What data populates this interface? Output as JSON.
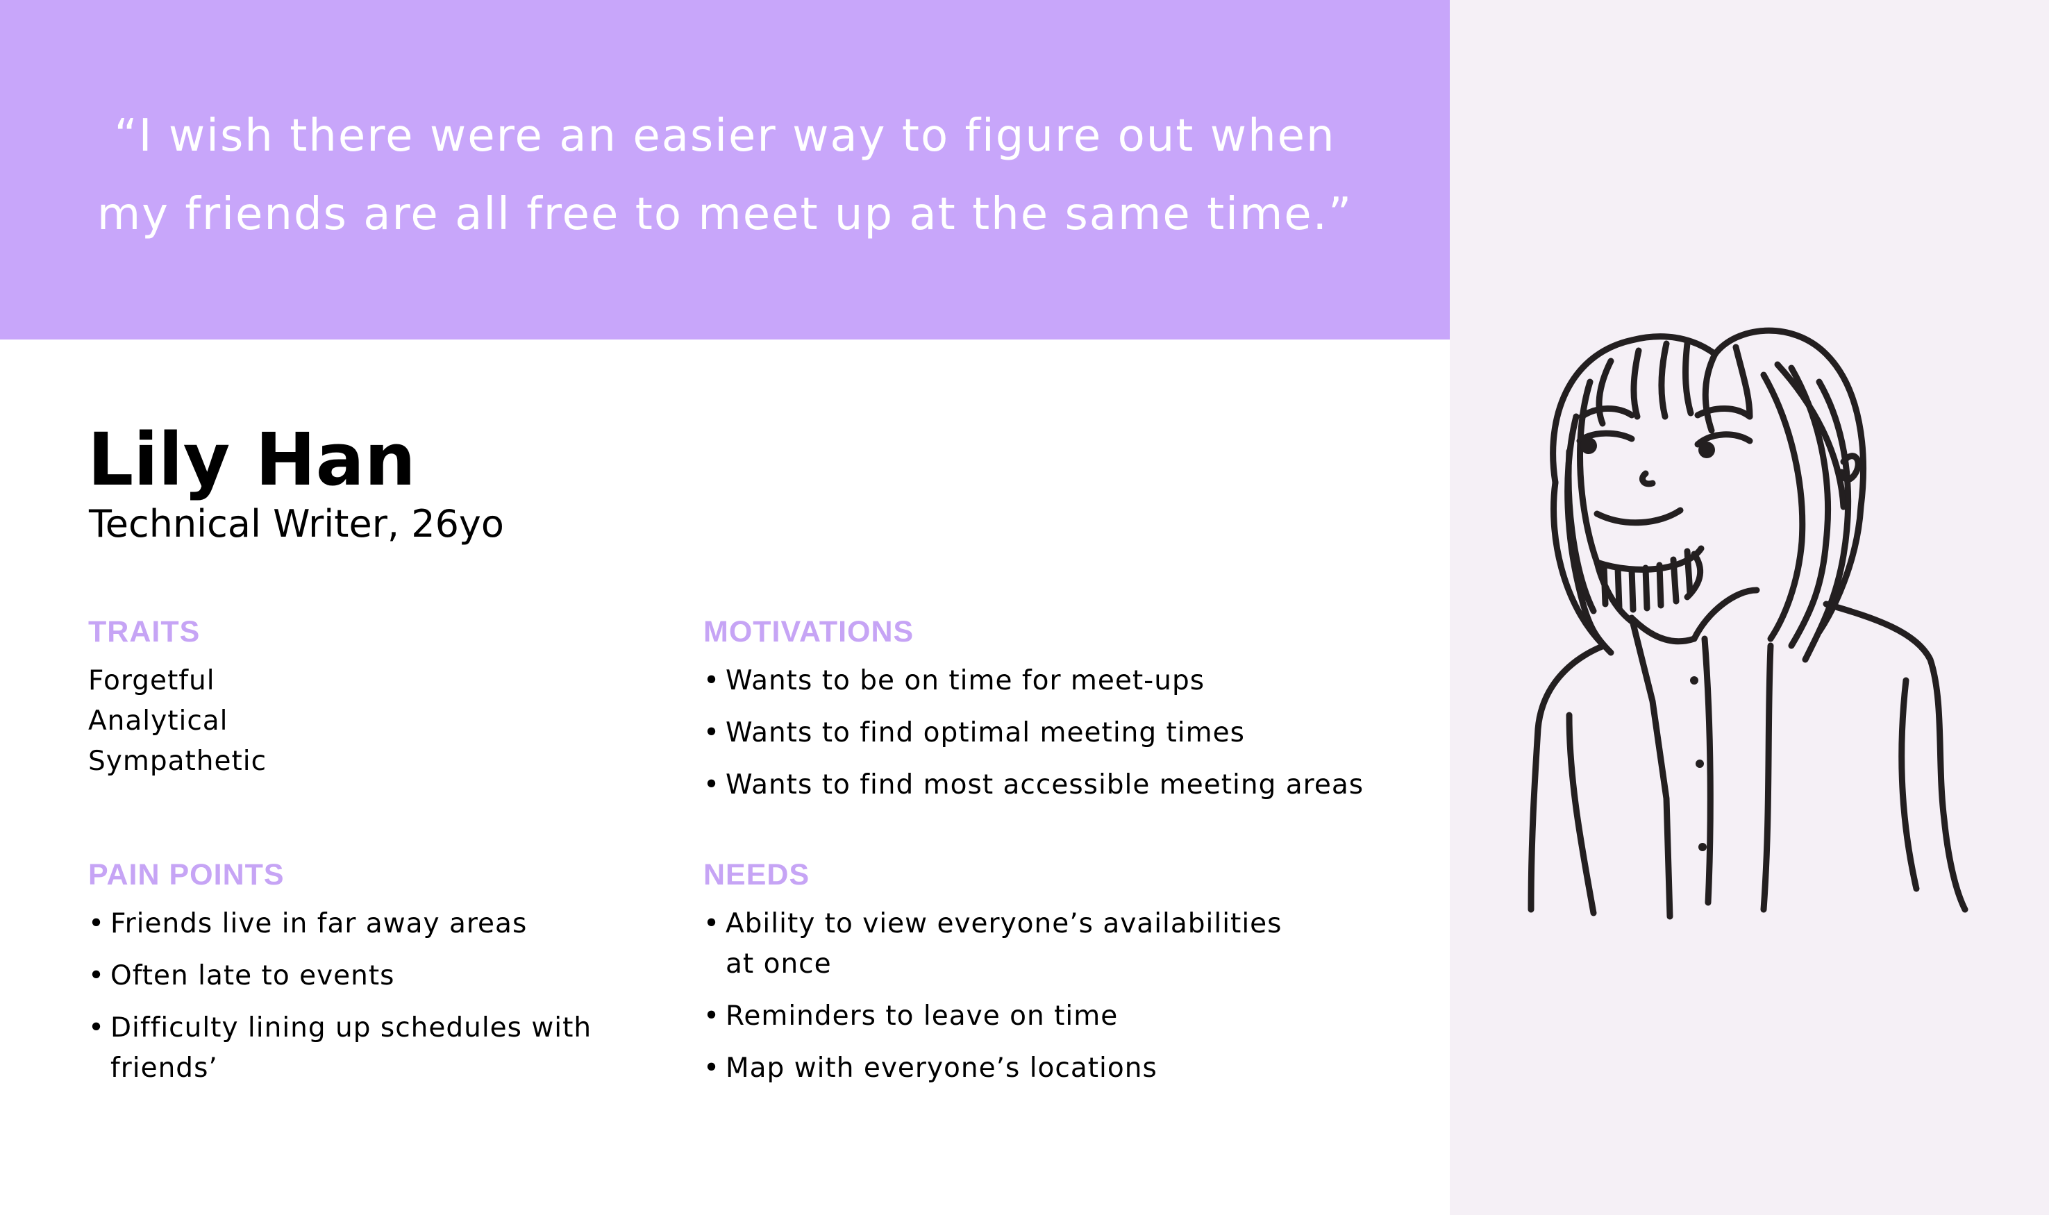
{
  "quote": "“I wish there were an easier way to figure out when my friends are all free to meet up at the same time.”",
  "persona": {
    "name": "Lily Han",
    "role": "Technical Writer, 26yo"
  },
  "traits": {
    "heading": "TRAITS",
    "items": [
      "Forgetful",
      "Analytical",
      "Sympathetic"
    ]
  },
  "motivations": {
    "heading": "MOTIVATIONS",
    "items": [
      "Wants to be on time for meet-ups",
      "Wants to find optimal meeting times",
      "Wants to find most accessible meeting areas"
    ]
  },
  "pain_points": {
    "heading": "PAIN POINTS",
    "items": [
      "Friends live in far away areas",
      "Often late to events",
      "Difficulty lining up schedules with friends’"
    ]
  },
  "needs": {
    "heading": "NEEDS",
    "items": [
      "Ability to view everyone’s availabilities at once",
      "Reminders to leave on time",
      "Map with everyone’s locations"
    ]
  },
  "colors": {
    "banner": "#c8a6fa",
    "heading_accent": "#c6a4f5",
    "side_panel": "#f5f0f6",
    "text": "#000000"
  }
}
